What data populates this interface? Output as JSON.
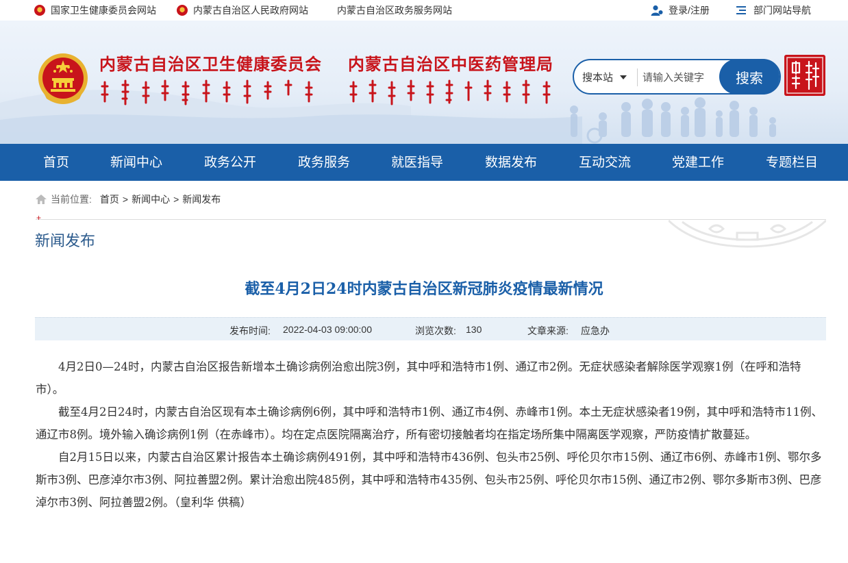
{
  "topbar": {
    "link1": "国家卫生健康委员会网站",
    "link2": "内蒙古自治区人民政府网站",
    "link3": "内蒙古自治区政务服务网站",
    "login": "登录/注册",
    "dept_nav": "部门网站导航"
  },
  "header": {
    "title_left": "内蒙古自治区卫生健康委员会",
    "title_right": "内蒙古自治区中医药管理局",
    "brand_color": "#c8141b"
  },
  "search": {
    "scope": "搜本站",
    "placeholder": "请输入关键字",
    "button": "搜索"
  },
  "nav": {
    "items": [
      "首页",
      "新闻中心",
      "政务公开",
      "政务服务",
      "就医指导",
      "数据发布",
      "互动交流",
      "党建工作",
      "专题栏目"
    ],
    "color": "#1a5fa8"
  },
  "breadcrumb": {
    "label": "当前位置:",
    "items": [
      "首页",
      "新闻中心",
      "新闻发布"
    ],
    "separator": ">"
  },
  "section": {
    "plus": "+",
    "title": "新闻发布"
  },
  "article": {
    "title": "截至4月2日24时内蒙古自治区新冠肺炎疫情最新情况",
    "publish_label": "发布时间:",
    "publish_time": "2022-04-03 09:00:00",
    "views_label": "浏览次数:",
    "views": "130",
    "source_label": "文章来源:",
    "source": "应急办",
    "paragraphs": [
      "4月2日0—24时，内蒙古自治区报告新增本土确诊病例治愈出院3例，其中呼和浩特市1例、通辽市2例。无症状感染者解除医学观察1例（在呼和浩特市）。",
      "截至4月2日24时，内蒙古自治区现有本土确诊病例6例，其中呼和浩特市1例、通辽市4例、赤峰市1例。本土无症状感染者19例，其中呼和浩特市11例、通辽市8例。境外输入确诊病例1例（在赤峰市）。均在定点医院隔离治疗，所有密切接触者均在指定场所集中隔离医学观察，严防疫情扩散蔓延。",
      "自2月15日以来，内蒙古自治区累计报告本土确诊病例491例，其中呼和浩特市436例、包头市25例、呼伦贝尔市15例、通辽市6例、赤峰市1例、鄂尔多斯市3例、巴彦淖尔市3例、阿拉善盟2例。累计治愈出院485例，其中呼和浩特市435例、包头市25例、呼伦贝尔市15例、通辽市2例、鄂尔多斯市3例、巴彦淖尔市3例、阿拉善盟2例。（皇利华 供稿）"
    ]
  }
}
